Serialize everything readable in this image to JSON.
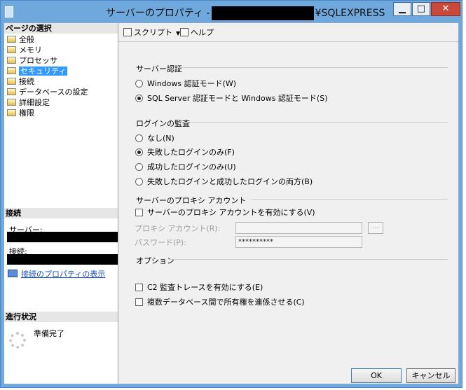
{
  "window": {
    "title_prefix": "サーバーのプロパティ -",
    "title_suffix": "¥SQLEXPRESS",
    "min_glyph": "▁",
    "max_glyph": "□",
    "close_glyph": "✕"
  },
  "left": {
    "pages_header": "ページの選択",
    "pages": [
      {
        "label": "全般",
        "selected": false
      },
      {
        "label": "メモリ",
        "selected": false
      },
      {
        "label": "プロセッサ",
        "selected": false
      },
      {
        "label": "セキュリティ",
        "selected": true
      },
      {
        "label": "接続",
        "selected": false
      },
      {
        "label": "データベースの設定",
        "selected": false
      },
      {
        "label": "詳細設定",
        "selected": false
      },
      {
        "label": "権限",
        "selected": false
      }
    ],
    "connection_header": "接続",
    "server_label": "サーバー:",
    "connection_label": "接続:",
    "view_properties_link": "接続のプロパティの表示",
    "progress_header": "進行状況",
    "progress_status": "準備完了"
  },
  "toolbar": {
    "script_label": "スクリプト",
    "help_label": "ヘルプ"
  },
  "auth": {
    "title": "サーバー認証",
    "windows_mode": "Windows 認証モード(W)",
    "mixed_mode": "SQL Server 認証モードと Windows 認証モード(S)",
    "selected": "mixed"
  },
  "audit": {
    "title": "ログインの監査",
    "none": "なし(N)",
    "failed_only": "失敗したログインのみ(F)",
    "success_only": "成功したログインのみ(U)",
    "both": "失敗したログインと成功したログインの両方(B)",
    "selected": "failed_only"
  },
  "proxy": {
    "title": "サーバーのプロキシ アカウント",
    "enable_label": "サーバーのプロキシ アカウントを有効にする(V)",
    "account_label": "プロキシ アカウント(R):",
    "account_value": "",
    "password_label": "パスワード(P):",
    "password_value": "**********",
    "browse_label": "..."
  },
  "options": {
    "title": "オプション",
    "c2_audit": "C2 監査トレースを有効にする(E)",
    "cross_db_chaining": "複数データベース間で所有権を連係させる(C)"
  },
  "buttons": {
    "ok": "OK",
    "cancel": "キャンセル"
  }
}
